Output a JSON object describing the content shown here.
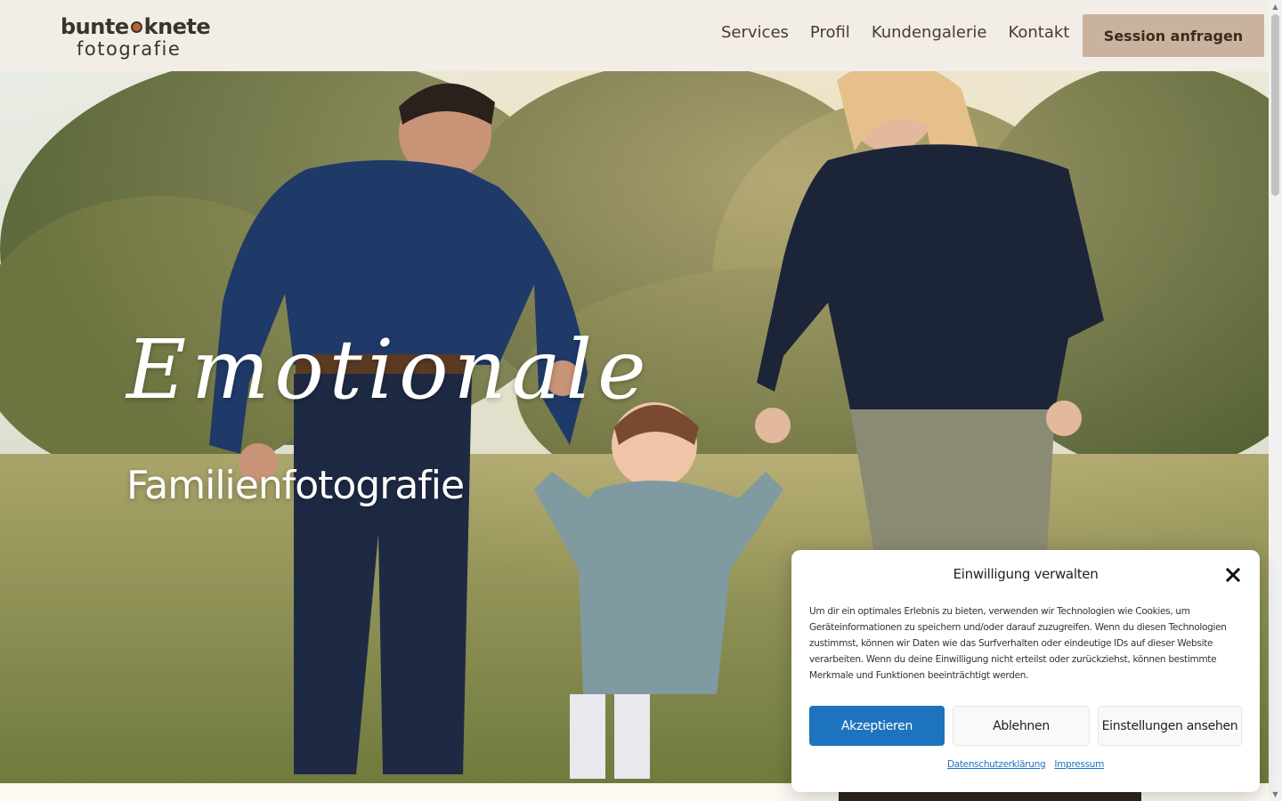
{
  "header": {
    "logo_top_left": "bunte",
    "logo_top_right": "knete",
    "logo_bottom": "fotografie",
    "nav": [
      {
        "label": "Services"
      },
      {
        "label": "Profil"
      },
      {
        "label": "Kundengalerie"
      },
      {
        "label": "Kontakt"
      }
    ],
    "cta_label": "Session anfragen"
  },
  "hero": {
    "script_title": "Emotionale",
    "subtitle": "Familienfotografie"
  },
  "consent": {
    "title": "Einwilligung verwalten",
    "text": "Um dir ein optimales Erlebnis zu bieten, verwenden wir Technologien wie Cookies, um Geräteinformationen zu speichern und/oder darauf zuzugreifen. Wenn du diesen Technologien zustimmst, können wir Daten wie das Surfverhalten oder eindeutige IDs auf dieser Website verarbeiten. Wenn du deine Einwilligung nicht erteilst oder zurückziehst, können bestimmte Merkmale und Funktionen beeinträchtigt werden.",
    "accept_label": "Akzeptieren",
    "deny_label": "Ablehnen",
    "settings_label": "Einstellungen ansehen",
    "privacy_link": "Datenschutzerklärung",
    "imprint_link": "Impressum"
  },
  "colors": {
    "header_bg": "#f3ede7",
    "cta_bg": "#c9b29e",
    "accent_blue": "#1e73be",
    "logo_dot": "#b8652c"
  }
}
